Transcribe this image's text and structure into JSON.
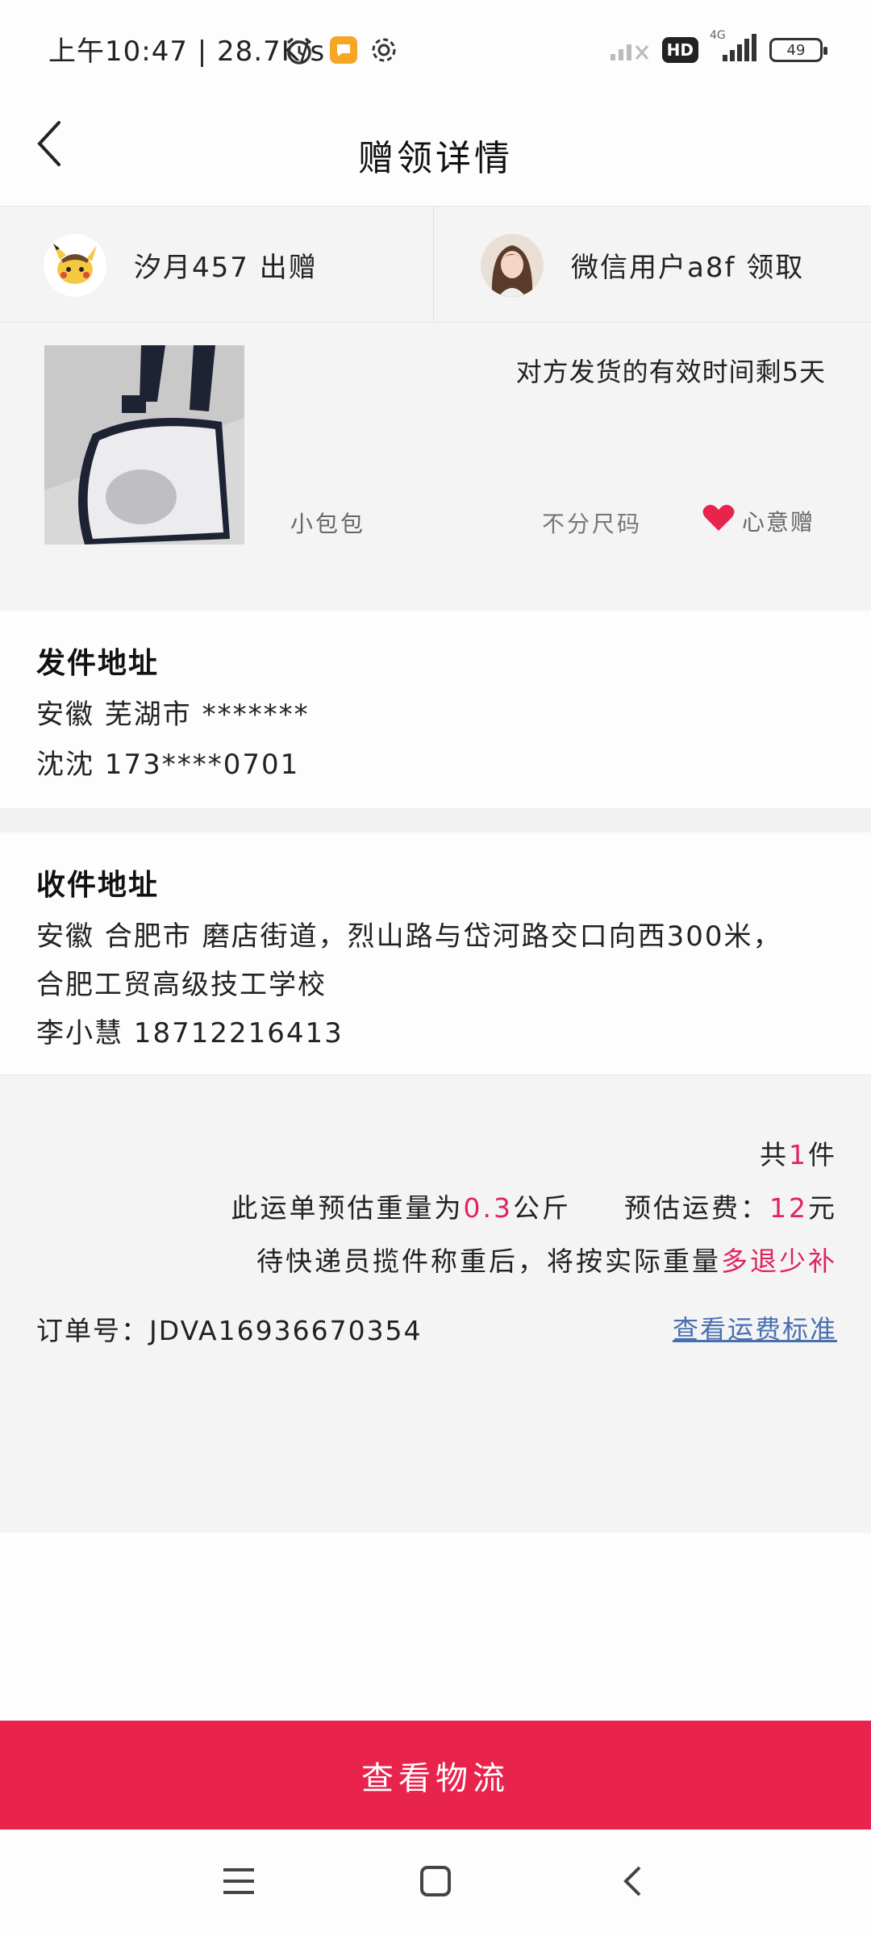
{
  "status_bar": {
    "text": "上午10:47 | 28.7K/s",
    "hd": "HD",
    "network": "4G",
    "battery": "49"
  },
  "nav": {
    "title": "赠领详情"
  },
  "users": {
    "giver": "汐月457 出赠",
    "receiver": "微信用户a8f 领取"
  },
  "product": {
    "valid_note": "对方发货的有效时间剩5天",
    "name": "小包包",
    "size": "不分尺码",
    "tag": "心意赠"
  },
  "sender_address": {
    "title": "发件地址",
    "line1": "安徽 芜湖市 *******",
    "line2": "沈沈 173****0701"
  },
  "receiver_address": {
    "title": "收件地址",
    "line1": "安徽 合肥市 磨店街道，烈山路与岱河路交口向西300米，",
    "line2": "合肥工贸高级技工学校",
    "line3": "李小慧 18712216413"
  },
  "shipping": {
    "count_prefix": "共",
    "count": "1",
    "count_suffix": "件",
    "weight_prefix": "此运单预估重量为",
    "weight": "0.3",
    "weight_unit": "公斤",
    "fee_prefix": "预估运费：",
    "fee": "12",
    "fee_unit": "元",
    "note_prefix": "待快递员揽件称重后，将按实际重量",
    "note_highlight": "多退少补",
    "order_label": "订单号：",
    "order_no": "JDVA16936670354",
    "fee_link": "查看运费标准"
  },
  "buttons": {
    "logistics": "查看物流"
  },
  "colors": {
    "accent": "#e8244d",
    "highlight": "#e0245e",
    "link": "#4a6fb0",
    "section_bg": "#f4f4f4"
  },
  "icons": [
    "alarm-icon",
    "message-icon",
    "settings-icon",
    "signal-icon",
    "back-icon",
    "heart-icon",
    "menu-icon",
    "home-icon",
    "nav-back-icon"
  ]
}
